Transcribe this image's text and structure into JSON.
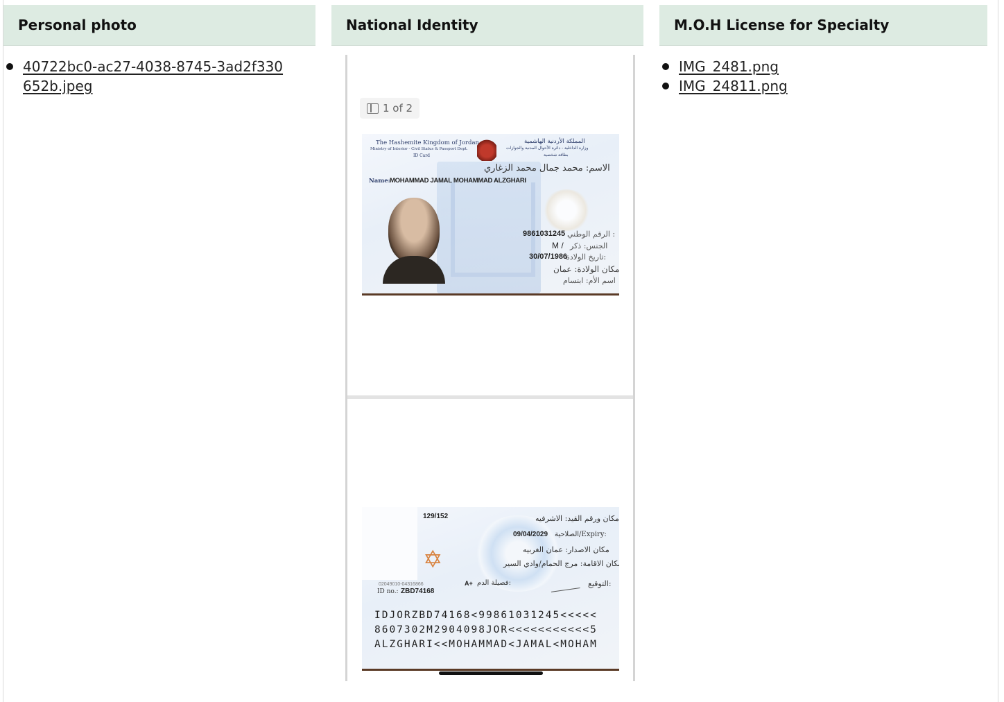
{
  "columns": [
    {
      "title": "Personal photo",
      "files": [
        "40722bc0-ac27-4038-8745-3ad2f330652b.jpeg"
      ]
    },
    {
      "title": "National Identity",
      "files": []
    },
    {
      "title": "M.O.H License for Specialty",
      "files": [
        "IMG_2481.png",
        "IMG_24811.png"
      ]
    }
  ],
  "viewer": {
    "page_indicator": "1 of 2",
    "id_front": {
      "header_en_1": "The Hashemite Kingdom of Jordan",
      "header_en_2": "Ministry of Interior - Civil Status & Passport Dept.",
      "header_en_3": "ID Card",
      "header_ar_1": "المملكة الأردنية الهاشمية",
      "header_ar_2": "وزارة الداخلية - دائرة الأحوال المدنية والجوازات",
      "header_ar_3": "بطاقة شخصية",
      "name_ar": "الاسم: محمد جمال محمد الزغاري",
      "name_label": "Name:",
      "name_en": "MOHAMMAD JAMAL MOHAMMAD ALZGHARI",
      "national_no_label": "الرقم الوطني :",
      "national_no": "9861031245",
      "sex_label": "الجنس: ذكر",
      "sex": "M /",
      "dob_label": "تاريخ الولادة:",
      "dob": "30/07/1986",
      "pob": "مكان الولادة: عمان",
      "mother": "اسم الأم: ابتسام"
    },
    "id_back": {
      "reg_no": "129/152",
      "place_reg": "مكان ورقم القيد: الاشرفيه",
      "expiry_label": "الصلاحية/Expiry:",
      "expiry": "09/04/2029",
      "issue_place": "مكان الاصدار: عمان الغربيه",
      "residence": "مكان الاقامة: مرج الحمام/وادي السير",
      "signature_label": "التوقيع:",
      "blood_label": "فصيلة الدم:",
      "blood": "A+",
      "serial": "02049010-04316866",
      "id_no_label": "ID no.:",
      "id_no": "ZBD74168",
      "mrz": [
        "IDJORZBD74168<99861031245<<<<<",
        "8607302M2904098JOR<<<<<<<<<<<5",
        "ALZGHARI<<MOHAMMAD<JAMAL<MOHAM"
      ]
    }
  }
}
